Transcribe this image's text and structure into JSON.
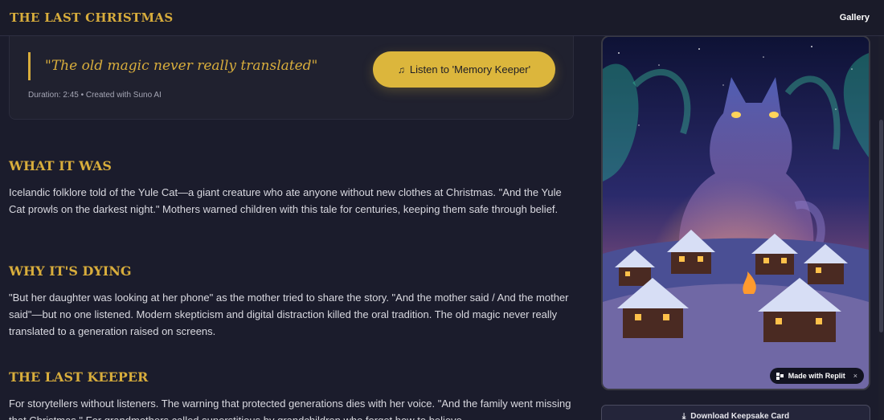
{
  "header": {
    "title": "THE LAST CHRISTMAS",
    "nav_gallery": "Gallery"
  },
  "song_card": {
    "quote": "\"The old magic never really translated\"",
    "meta": "Duration: 2:45 • Created with Suno AI",
    "listen_button": "Listen to 'Memory Keeper'",
    "listen_icon": "music-note-icon"
  },
  "sections": [
    {
      "title": "WHAT IT WAS",
      "body": "Icelandic folklore told of the Yule Cat—a giant creature who ate anyone without new clothes at Christmas. \"And the Yule Cat prowls on the darkest night.\" Mothers warned children with this tale for centuries, keeping them safe through belief."
    },
    {
      "title": "WHY IT'S DYING",
      "body": "\"But her daughter was looking at her phone\" as the mother tried to share the story. \"And the mother said / And the mother said\"—but no one listened. Modern skepticism and digital distraction killed the oral tradition. The old magic never really translated to a generation raised on screens."
    },
    {
      "title": "THE LAST KEEPER",
      "body": "For storytellers without listeners. The warning that protected generations dies with her voice. \"And the family went missing that Christmas.\" For grandmothers called superstitious by grandchildren who forget how to believe."
    }
  ],
  "artwork": {
    "badge_label": "Made with Replit",
    "badge_close": "×"
  },
  "download": {
    "label": "Download Keepsake Card",
    "icon": "download-icon"
  },
  "colors": {
    "accent": "#d8ad3c",
    "background": "#1b1c2c"
  }
}
